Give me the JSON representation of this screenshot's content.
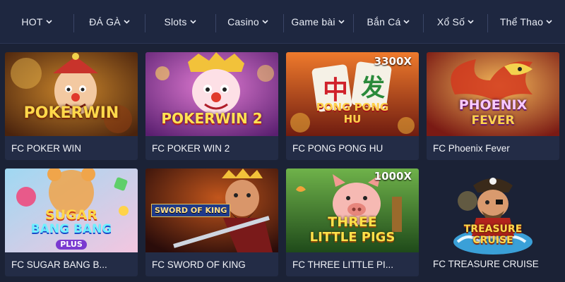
{
  "nav": {
    "items": [
      {
        "label": "HOT"
      },
      {
        "label": "ĐÁ GÀ"
      },
      {
        "label": "Slots"
      },
      {
        "label": "Casino"
      },
      {
        "label": "Game bài"
      },
      {
        "label": "Bắn Cá"
      },
      {
        "label": "Xổ Số"
      },
      {
        "label": "Thể Thao"
      }
    ]
  },
  "games": [
    {
      "title": "FC POKER WIN",
      "logo": [
        "POKERWIN"
      ],
      "badge": ""
    },
    {
      "title": "FC POKER WIN 2",
      "logo": [
        "POKERWIN 2"
      ],
      "badge": ""
    },
    {
      "title": "FC PONG PONG HU",
      "logo": [
        "PONG PONG",
        "HU"
      ],
      "badge": "3300X"
    },
    {
      "title": "FC Phoenix Fever",
      "logo": [
        "PHOENIX",
        "FEVER"
      ],
      "badge": ""
    },
    {
      "title": "FC SUGAR BANG B...",
      "logo": [
        "SUGAR",
        "BANG BANG",
        "PLUS"
      ],
      "badge": ""
    },
    {
      "title": "FC SWORD OF KING",
      "logo": [
        "SWORD OF KING"
      ],
      "badge": ""
    },
    {
      "title": "FC THREE LITTLE PI...",
      "logo": [
        "THREE",
        "LITTLE PIGS"
      ],
      "badge": "1000X"
    },
    {
      "title": "FC TREASURE CRUISE",
      "logo": [
        "TREASURE",
        "CRUISE"
      ],
      "badge": ""
    }
  ],
  "colors": {
    "page_bg": "#1b2236",
    "nav_bg": "#1e2740",
    "card_bg": "#232c46"
  },
  "icons": {
    "nav_dropdown": "chevron-down-icon"
  }
}
